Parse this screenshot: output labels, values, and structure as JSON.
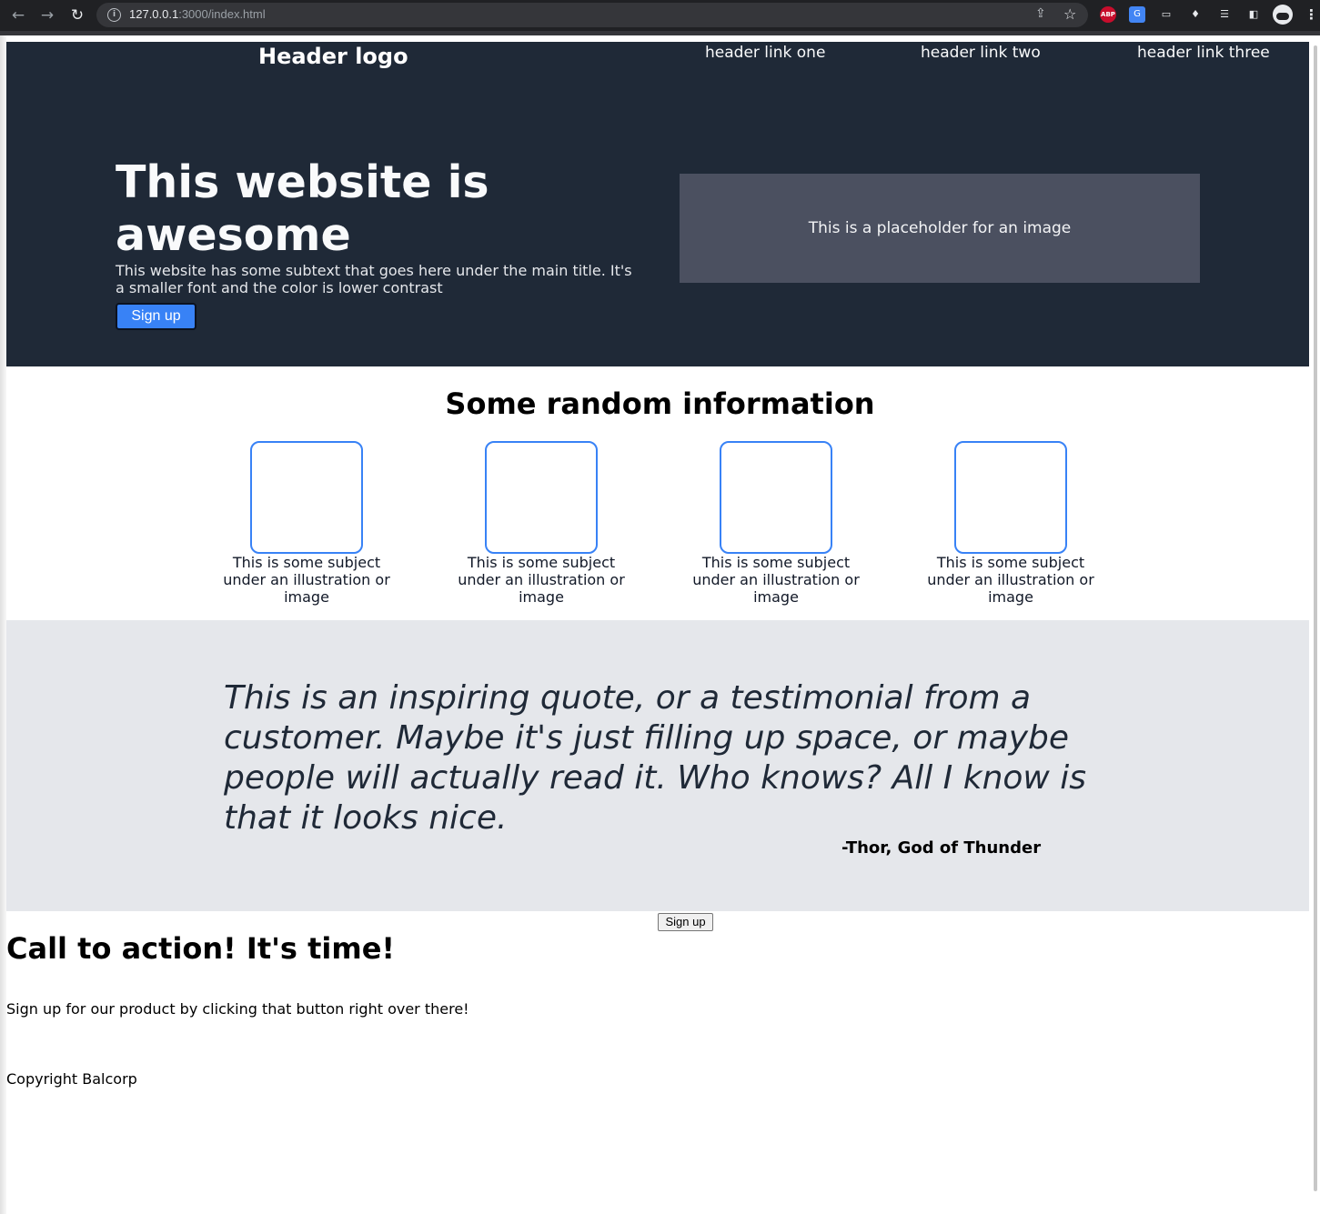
{
  "browser": {
    "url_host": "127.0.0.1",
    "url_rest": ":3000/index.html",
    "icons": [
      "back-arrow-icon",
      "forward-arrow-icon",
      "reload-icon",
      "info-icon",
      "share-icon",
      "star-icon",
      "adblock-icon",
      "translate-icon",
      "cast-icon",
      "extensions-icon",
      "media-icon",
      "side-panel-icon",
      "profile-avatar",
      "more-menu-icon"
    ],
    "abp_label": "ABP"
  },
  "header": {
    "logo": "Header logo",
    "links": [
      "header link one",
      "header link two",
      "header link three"
    ]
  },
  "hero": {
    "title": "This website is awesome",
    "subtitle": "This website has some subtext that goes here under the main title. It's a smaller font and the color is lower contrast",
    "button_label": "Sign up",
    "image_placeholder": "This is a placeholder for an image"
  },
  "info": {
    "title": "Some random information",
    "cards": [
      {
        "text": "This is some subject under an illustration or image"
      },
      {
        "text": "This is some subject under an illustration or image"
      },
      {
        "text": "This is some subject under an illustration or image"
      },
      {
        "text": "This is some subject under an illustration or image"
      }
    ]
  },
  "quote": {
    "text": "This is an inspiring quote, or a testimonial from a customer. Maybe it's just filling up space, or maybe people will actually read it. Who knows? All I know is that it looks nice.",
    "author": "-Thor, God of Thunder"
  },
  "cta": {
    "button_label": "Sign up",
    "title": "Call to action! It's time!",
    "text": "Sign up for our product by clicking that button right over there!"
  },
  "footer": {
    "copyright": "Copyright Balcorp"
  },
  "colors": {
    "hero_bg": "#1f2937",
    "accent": "#3882f6",
    "quote_bg": "#e5e7eb"
  }
}
